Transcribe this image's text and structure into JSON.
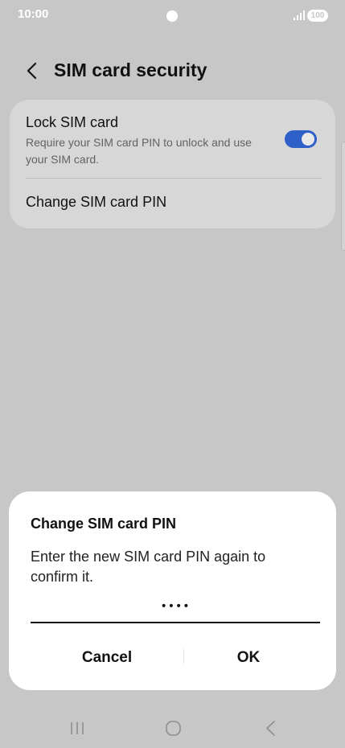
{
  "status_bar": {
    "time": "10:00",
    "battery": "100",
    "icons": [
      "camera-dot",
      "signal-icon",
      "battery-icon"
    ]
  },
  "header": {
    "title": "SIM card security",
    "back_icon": "chevron-left-icon"
  },
  "settings": {
    "lock_sim": {
      "title": "Lock SIM card",
      "description": "Require your SIM card PIN to unlock and use your SIM card.",
      "enabled": true
    },
    "change_pin": {
      "label": "Change SIM card PIN"
    }
  },
  "dialog": {
    "title": "Change SIM card PIN",
    "message": "Enter the new SIM card PIN again to confirm it.",
    "pin_value": "••••",
    "cancel_label": "Cancel",
    "ok_label": "OK"
  },
  "nav_bar": {
    "icons": [
      "recent-apps-icon",
      "home-icon",
      "back-icon"
    ]
  },
  "colors": {
    "accent": "#2f5fc9",
    "background": "#c7c7c7",
    "card": "#d7d7d7",
    "dialog": "#ffffff"
  }
}
